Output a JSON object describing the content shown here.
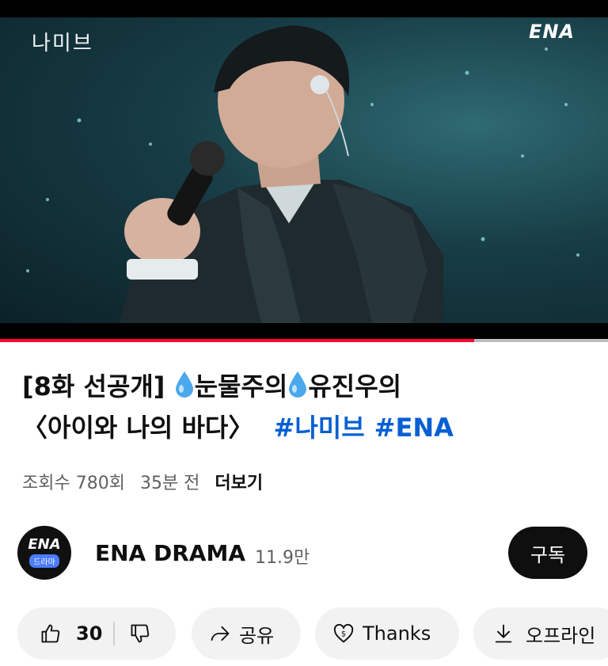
{
  "video": {
    "watermark": "나미브",
    "channel_logo": "ENA",
    "progress_fraction": 0.78
  },
  "title": {
    "part1": "[8화 선공개]",
    "icon1": "droplet-emoji",
    "part2": "눈물주의",
    "icon2": "droplet-emoji",
    "part3": "유진우의",
    "part4": "〈아이와 나의 바다〉",
    "hashtag1": "#나미브",
    "hashtag2": "#ENA",
    "hashtag_color": "#065fd4"
  },
  "meta": {
    "views": "조회수 780회",
    "time": "35분 전",
    "more": "더보기"
  },
  "channel": {
    "avatar_top": "ENA",
    "avatar_badge": "드라마",
    "name": "ENA DRAMA",
    "subscribers": "11.9만",
    "subscribe_label": "구독"
  },
  "actions": {
    "like_count": "30",
    "share_label": "공유",
    "thanks_label": "Thanks",
    "offline_label": "오프라인"
  },
  "colors": {
    "accent_red": "#ff0033",
    "pill_bg": "#f2f2f2",
    "text_primary": "#0f0f0f",
    "text_secondary": "#606060"
  }
}
